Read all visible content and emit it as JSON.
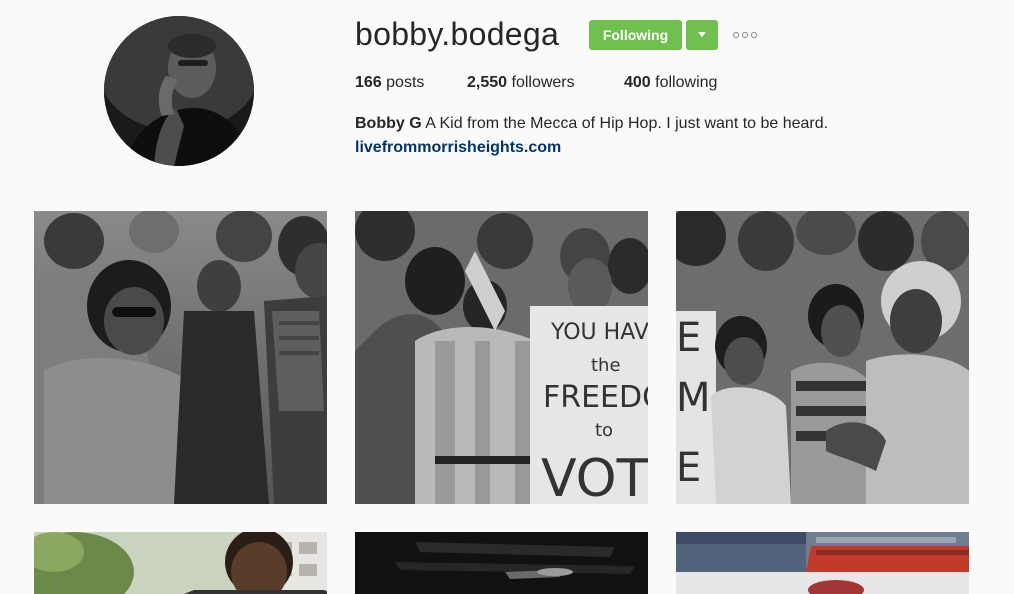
{
  "profile": {
    "username": "bobby.bodega",
    "follow_label": "Following",
    "stats": {
      "posts_count": "166",
      "posts_label": "posts",
      "followers_count": "2,550",
      "followers_label": "followers",
      "following_count": "400",
      "following_label": "following"
    },
    "bio_name": "Bobby G",
    "bio_text": "A Kid from the Mecca of Hip Hop. I just want to be heard.",
    "website": "livefrommorrisheights.com"
  },
  "photos": [
    {
      "id": 1,
      "subject": "civil-rights-crowd-sunglasses"
    },
    {
      "id": 2,
      "subject": "civil-rights-freedom-to-vote-sign",
      "sign_lines": [
        "YOU HAVE",
        "the",
        "FREEDOM",
        "to",
        "VOT"
      ]
    },
    {
      "id": 3,
      "subject": "civil-rights-women-clapping",
      "sign_letters": [
        "E",
        "M",
        "E"
      ]
    },
    {
      "id": 4,
      "subject": "portrait-outdoor"
    },
    {
      "id": 5,
      "subject": "interior-dark"
    },
    {
      "id": 6,
      "subject": "street-scene"
    }
  ],
  "colors": {
    "follow_green": "#70c050",
    "link_blue": "#003569",
    "background": "#fafafa"
  },
  "icons": {
    "caret": "chevron-down-icon",
    "options": "more-options-icon"
  }
}
